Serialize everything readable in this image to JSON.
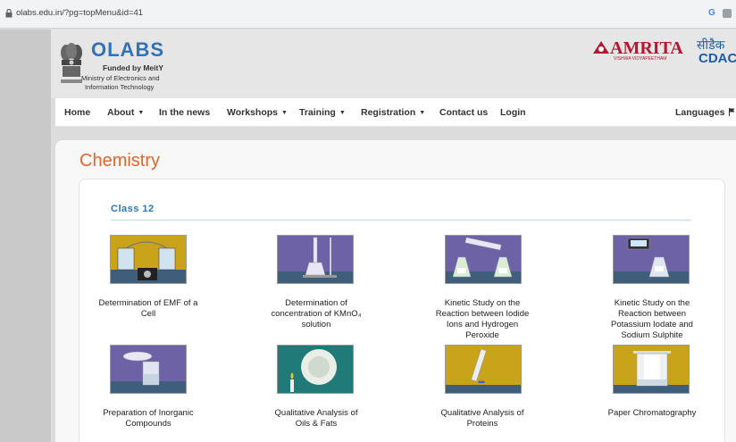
{
  "browser": {
    "url": "olabs.edu.in/?pg=topMenu&id=41",
    "profile_letter": "G"
  },
  "header": {
    "logo_text": "OLABS",
    "funded_by": "Funded by MeitY",
    "ministry_line1": "Ministry of Electronics and",
    "ministry_line2": "Information Technology",
    "partner1": "AMRITA",
    "partner1_sub": "VISHWA VIDYAPEETHAM",
    "partner2_hindi": "सीडैक",
    "partner2": "CDAC"
  },
  "nav": {
    "home": "Home",
    "about": "About",
    "news": "In the news",
    "workshops": "Workshops",
    "training": "Training",
    "registration": "Registration",
    "contact": "Contact us",
    "login": "Login",
    "languages": "Languages"
  },
  "page": {
    "title": "Chemistry",
    "class_title": "Class 12"
  },
  "experiments": [
    {
      "title_lines": [
        "Determination of EMF of a",
        "Cell"
      ]
    },
    {
      "title_lines": [
        "Determination of",
        "concentration of KMnO₄",
        "solution"
      ]
    },
    {
      "title_lines": [
        "Kinetic Study on the",
        "Reaction between Iodide",
        "Ions and Hydrogen",
        "Peroxide"
      ]
    },
    {
      "title_lines": [
        "Kinetic Study on the",
        "Reaction between",
        "Potassium Iodate and",
        "Sodium Sulphite"
      ]
    },
    {
      "title_lines": [
        "Preparation of Inorganic",
        "Compounds"
      ]
    },
    {
      "title_lines": [
        "Qualitative Analysis of",
        "Oils & Fats"
      ]
    },
    {
      "title_lines": [
        "Qualitative Analysis of",
        "Proteins"
      ]
    },
    {
      "title_lines": [
        "Paper Chromatography"
      ]
    }
  ],
  "colors": {
    "accent_orange": "#e3652b",
    "link_blue": "#2a78b8",
    "logo_blue": "#2f73b8",
    "amrita_red": "#b5172f"
  }
}
